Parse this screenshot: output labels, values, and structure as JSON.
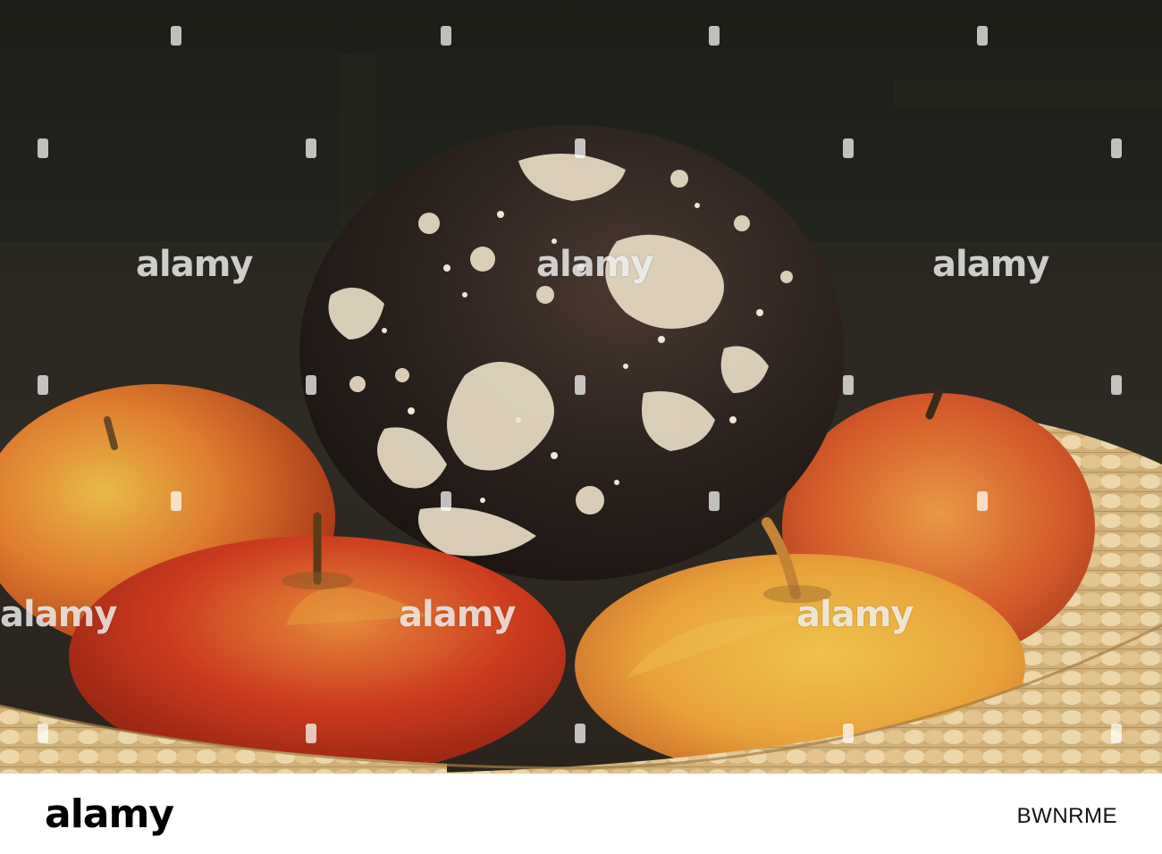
{
  "photo": {
    "subject": "mouldy-apple-on-fresh-apples-in-wicker-basket",
    "watermark_text": "alamy",
    "colors": {
      "background": "#1a1d14",
      "fresh_apple_red": "#c8321c",
      "fresh_apple_yellow": "#e6b43c",
      "rotten_apple": "#2a1f1a",
      "mould": "#e8dcc4",
      "wicker": "#e3c89a"
    }
  },
  "footer": {
    "logo": "alamy",
    "image_id": "BWNRME"
  }
}
